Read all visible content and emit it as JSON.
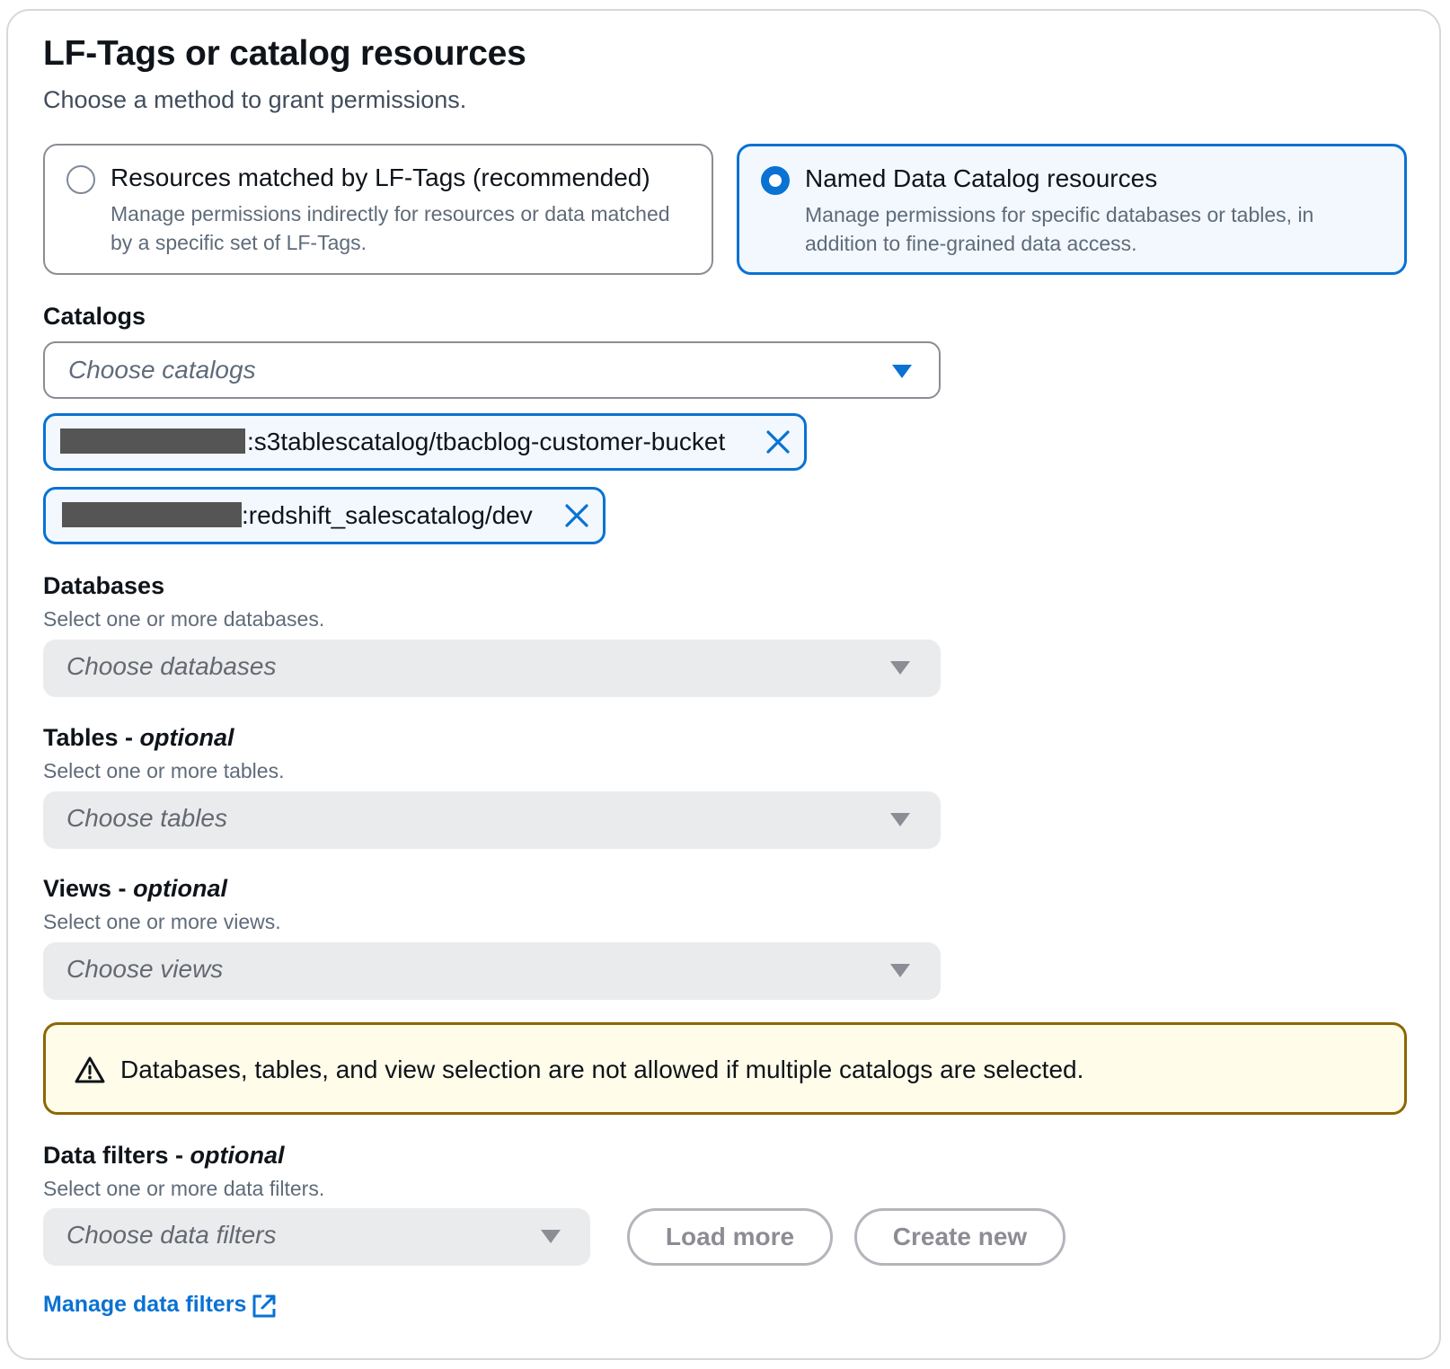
{
  "section": {
    "title": "LF-Tags or catalog resources",
    "subtitle": "Choose a method to grant permissions."
  },
  "method": {
    "options": [
      {
        "title": "Resources matched by LF-Tags (recommended)",
        "description": "Manage permissions indirectly for resources or data matched by a specific set of LF-Tags.",
        "selected": false
      },
      {
        "title": "Named Data Catalog resources",
        "description": "Manage permissions for specific databases or tables, in addition to fine-grained data access.",
        "selected": true
      }
    ]
  },
  "catalogs": {
    "label": "Catalogs",
    "placeholder": "Choose catalogs",
    "selected": [
      {
        "text": ":s3tablescatalog/tbacblog-customer-bucket"
      },
      {
        "text": ":redshift_salescatalog/dev"
      }
    ]
  },
  "databases": {
    "label": "Databases",
    "description": "Select one or more databases.",
    "placeholder": "Choose databases"
  },
  "tables": {
    "label": "Tables - ",
    "optional": "optional",
    "description": "Select one or more tables.",
    "placeholder": "Choose tables"
  },
  "views": {
    "label": "Views - ",
    "optional": "optional",
    "description": "Select one or more views.",
    "placeholder": "Choose views"
  },
  "alert": {
    "text": "Databases, tables, and view selection are not allowed if multiple catalogs are selected."
  },
  "data_filters": {
    "label": "Data filters - ",
    "optional": "optional",
    "description": "Select one or more data filters.",
    "placeholder": "Choose data filters",
    "load_more": "Load more",
    "create_new": "Create new",
    "manage_link": "Manage data filters"
  },
  "colors": {
    "accent": "#0972d3",
    "warning_border": "#8d6605",
    "warning_bg": "#fffce9"
  }
}
